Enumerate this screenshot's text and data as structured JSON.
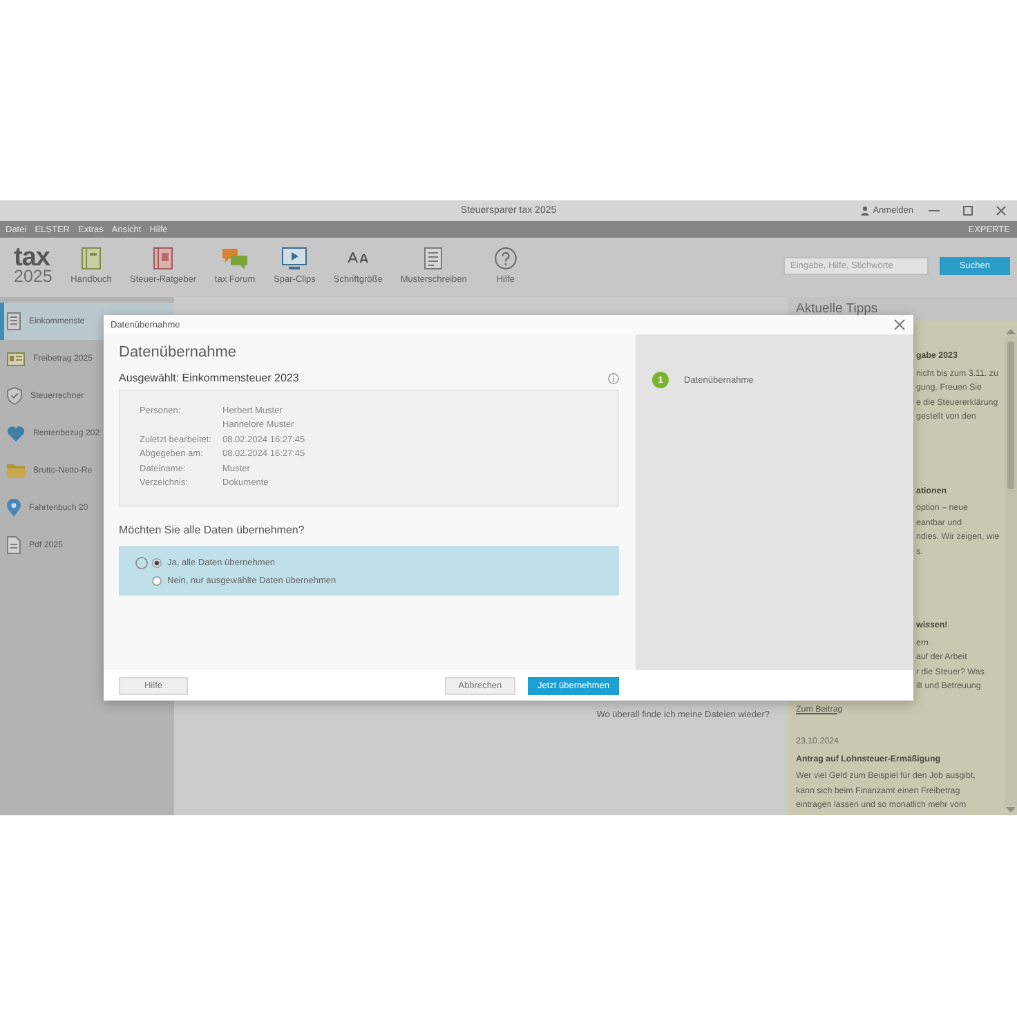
{
  "window": {
    "title": "Steuersparer tax 2025",
    "account": "Anmelden"
  },
  "menu": {
    "items": [
      "Datei",
      "ELSTER",
      "Extras",
      "Ansicht",
      "Hilfe"
    ],
    "mode": "EXPERTE"
  },
  "toolbar": {
    "logo": {
      "name": "tax",
      "year": "2025"
    },
    "items": [
      {
        "kind": "book",
        "label": "Handbuch"
      },
      {
        "kind": "guide",
        "label": "Steuer-Ratgeber"
      },
      {
        "kind": "forum",
        "label": "tax Forum"
      },
      {
        "kind": "video",
        "label": "Spar-Clips"
      },
      {
        "kind": "font",
        "label": "Schriftgröße"
      },
      {
        "kind": "letter",
        "label": "Musterschreiben"
      },
      {
        "kind": "help",
        "label": "Hilfe"
      }
    ],
    "search": {
      "placeholder": "Eingabe, Hilfe, Stichworte",
      "button": "Suchen"
    }
  },
  "sidebar": {
    "items": [
      {
        "kind": "form",
        "label": "Einkommenste",
        "selected": true
      },
      {
        "kind": "card",
        "label": "Freibetrag 2025",
        "selected": false
      },
      {
        "kind": "shield",
        "label": "Steuerrechner",
        "selected": false
      },
      {
        "kind": "heart",
        "label": "Rentenbezug 202",
        "selected": false
      },
      {
        "kind": "folder",
        "label": "Brutto-Netto-Re",
        "selected": false
      },
      {
        "kind": "pin",
        "label": "Fahrtenbuch 20",
        "selected": false
      },
      {
        "kind": "document",
        "label": "Pdf 2025",
        "selected": false
      }
    ]
  },
  "main": {
    "link": "Wo überall finde ich meine Dateien wieder?"
  },
  "tips": {
    "title": "Aktuelle Tipps",
    "covered": [
      {
        "heading": "gabe 2023",
        "lines": [
          "nicht bis zum 3.11. zu",
          "gung. Freuen Sie",
          "e die Steuererklärung",
          "gestellt von den"
        ]
      },
      {
        "heading": "ationen",
        "lines": [
          "option – neue",
          "eantbar und",
          "ndies. Wir zeigen, wie",
          "s."
        ]
      },
      {
        "heading": "wissen!",
        "lines": [
          "ern",
          "auf der Arbeit",
          "r die Steuer? Was",
          "ilt und Betreuung"
        ]
      }
    ],
    "link": "Zum Beitrag",
    "date": "23.10.2024",
    "headline": "Antrag auf Lohnsteuer-Ermäßigung",
    "lines": [
      "Wer viel Geld zum Beispiel für den Job ausgibt,",
      "kann sich beim Finanzamt einen Freibetrag",
      "eintragen lassen und so monatlich mehr vom"
    ]
  },
  "dialog": {
    "title": "Datenübernahme",
    "heading": "Datenübernahme",
    "selection": "Ausgewählt: Einkommensteuer 2023",
    "details": [
      {
        "label": "Personen:",
        "values": [
          "Herbert Muster",
          "Hannelore Muster"
        ]
      },
      {
        "label": "Zuletzt bearbeitet:",
        "values": [
          "08.02.2024 16:27:45"
        ]
      },
      {
        "label": "Abgegeben am:",
        "values": [
          "08.02.2024 16:27:45"
        ]
      },
      {
        "label": "Dateiname:",
        "values": [
          "Muster"
        ]
      },
      {
        "label": "Verzeichnis:",
        "values": [
          "Dokumente"
        ]
      }
    ],
    "question": "Möchten Sie alle Daten übernehmen?",
    "options": [
      {
        "label": "Ja, alle Daten übernehmen",
        "selected": true,
        "hovered": true
      },
      {
        "label": "Nein, nur ausgewählte Daten übernehmen",
        "selected": false,
        "hovered": false
      }
    ],
    "steps": [
      {
        "number": "1",
        "label": "Datenübernahme",
        "active": true
      }
    ],
    "help_button": "Hilfe",
    "buttons": [
      {
        "kind": "secondary",
        "label": "Abbrechen"
      },
      {
        "kind": "primary",
        "label": "Jetzt übernehmen"
      }
    ]
  }
}
